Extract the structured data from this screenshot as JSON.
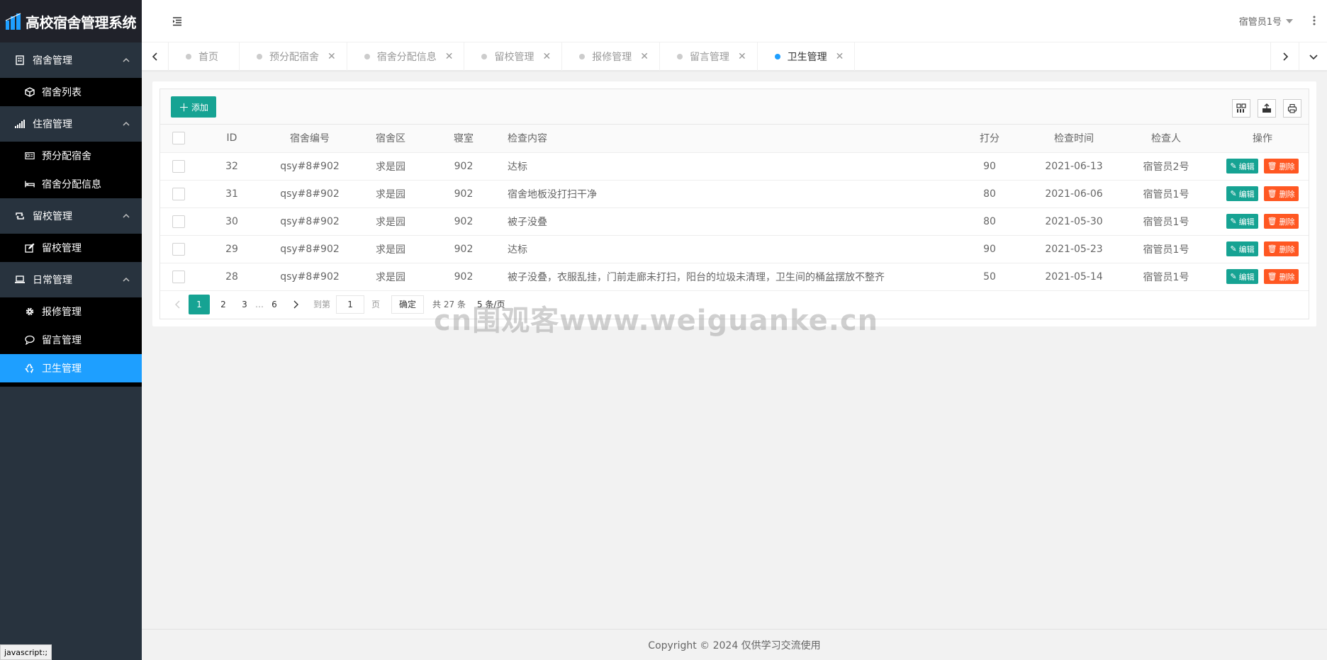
{
  "app": {
    "title": "高校宿舍管理系统",
    "accent": "#16a393",
    "sidebar_active_color": "#1e9fff"
  },
  "sidebar": {
    "groups": [
      {
        "label": "宿舍管理",
        "icon": "building-icon",
        "items": [
          {
            "label": "宿舍列表",
            "icon": "cube-icon"
          }
        ]
      },
      {
        "label": "住宿管理",
        "icon": "signal-icon",
        "items": [
          {
            "label": "预分配宿舍",
            "icon": "id-card-icon"
          },
          {
            "label": "宿舍分配信息",
            "icon": "bed-icon"
          }
        ]
      },
      {
        "label": "留校管理",
        "icon": "retweet-icon",
        "items": [
          {
            "label": "留校管理",
            "icon": "edit-icon"
          }
        ]
      },
      {
        "label": "日常管理",
        "icon": "laptop-icon",
        "items": [
          {
            "label": "报修管理",
            "icon": "gear-icon"
          },
          {
            "label": "留言管理",
            "icon": "comment-icon"
          },
          {
            "label": "卫生管理",
            "icon": "recycle-icon",
            "active": true
          }
        ]
      }
    ]
  },
  "header": {
    "user": "宿管员1号"
  },
  "tabs": [
    {
      "label": "首页",
      "closable": false,
      "active": false
    },
    {
      "label": "预分配宿舍",
      "closable": true,
      "active": false
    },
    {
      "label": "宿舍分配信息",
      "closable": true,
      "active": false
    },
    {
      "label": "留校管理",
      "closable": true,
      "active": false
    },
    {
      "label": "报修管理",
      "closable": true,
      "active": false
    },
    {
      "label": "留言管理",
      "closable": true,
      "active": false
    },
    {
      "label": "卫生管理",
      "closable": true,
      "active": true
    }
  ],
  "toolbar": {
    "add_label": "添加",
    "tool_icons": [
      "columns-icon",
      "export-icon",
      "print-icon"
    ]
  },
  "table": {
    "columns": [
      "ID",
      "宿舍编号",
      "宿舍区",
      "寝室",
      "检查内容",
      "打分",
      "检查时间",
      "检查人",
      "操作"
    ],
    "rows": [
      {
        "id": "32",
        "dorm_no": "qsy#8#902",
        "area": "求是园",
        "room": "902",
        "content": "达标",
        "score": "90",
        "time": "2021-06-13",
        "inspector": "宿管员2号"
      },
      {
        "id": "31",
        "dorm_no": "qsy#8#902",
        "area": "求是园",
        "room": "902",
        "content": "宿舍地板没打扫干净",
        "score": "80",
        "time": "2021-06-06",
        "inspector": "宿管员1号"
      },
      {
        "id": "30",
        "dorm_no": "qsy#8#902",
        "area": "求是园",
        "room": "902",
        "content": "被子没叠",
        "score": "80",
        "time": "2021-05-30",
        "inspector": "宿管员1号"
      },
      {
        "id": "29",
        "dorm_no": "qsy#8#902",
        "area": "求是园",
        "room": "902",
        "content": "达标",
        "score": "90",
        "time": "2021-05-23",
        "inspector": "宿管员1号"
      },
      {
        "id": "28",
        "dorm_no": "qsy#8#902",
        "area": "求是园",
        "room": "902",
        "content": "被子没叠，衣服乱挂，门前走廊未打扫，阳台的垃圾未清理，卫生间的桶盆摆放不整齐",
        "score": "50",
        "time": "2021-05-14",
        "inspector": "宿管员1号"
      }
    ],
    "edit_label": "编辑",
    "delete_label": "删除"
  },
  "pagination": {
    "pages": [
      "1",
      "2",
      "3",
      "6"
    ],
    "ellipsis": "…",
    "current": "1",
    "goto_label": "到第",
    "page_input": "1",
    "page_unit": "页",
    "confirm_label": "确定",
    "total": "共 27 条",
    "limit": "5 条/页"
  },
  "watermark": "cn围观客www.weiguanke.cn",
  "footer": {
    "copyright": "Copyright © 2024 仅供学习交流使用"
  },
  "status_bar": "javascript:;"
}
